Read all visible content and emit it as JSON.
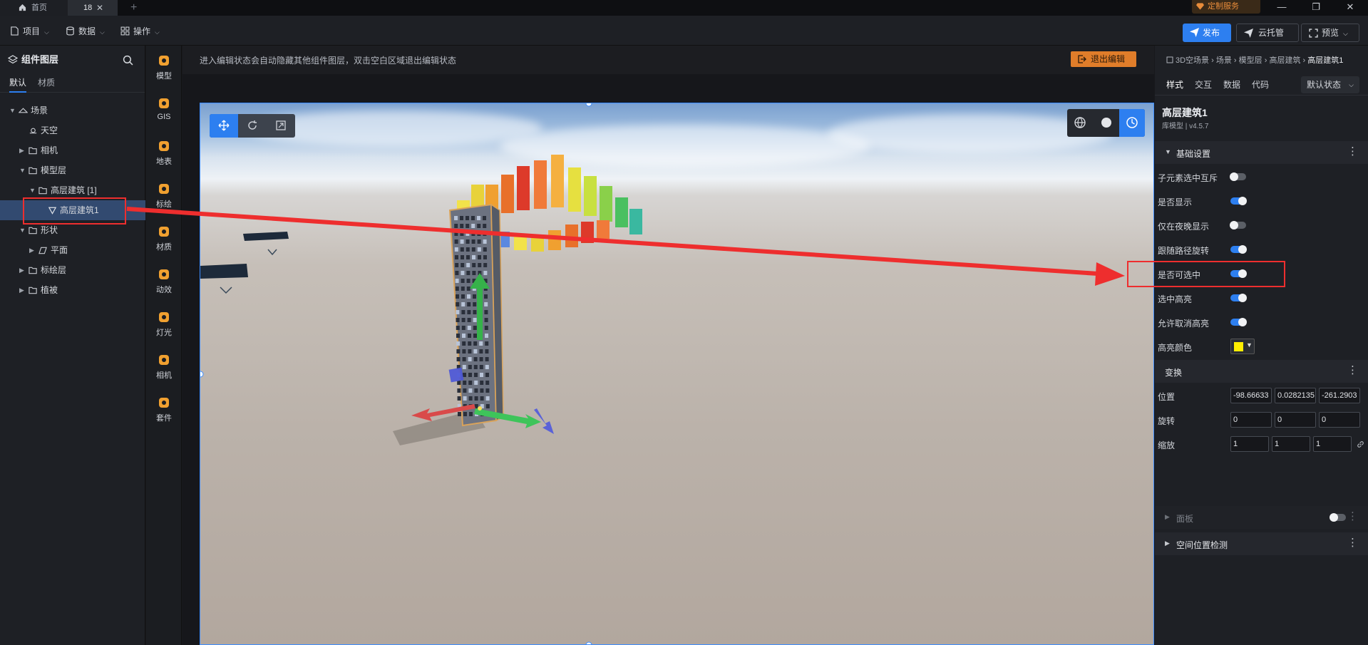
{
  "tabs": {
    "home": "首页",
    "current": "18",
    "add": "+"
  },
  "custom_service": "定制服务",
  "window": {
    "minimize": "—",
    "restore": "❐",
    "close": "✕"
  },
  "menus": {
    "project": "项目",
    "data": "数据",
    "operate": "操作"
  },
  "actions": {
    "publish": "发布",
    "cloud": "云托管",
    "preview": "预览"
  },
  "layers": {
    "title": "组件图层",
    "tabs": {
      "default": "默认",
      "material": "材质"
    },
    "tree": [
      {
        "label": "场景",
        "level": 0,
        "arrow": "▼",
        "icon": "scene-icon"
      },
      {
        "label": "天空",
        "level": 1,
        "arrow": "",
        "icon": "sky-icon"
      },
      {
        "label": "相机",
        "level": 1,
        "arrow": "▶",
        "icon": "folder-icon"
      },
      {
        "label": "模型层",
        "level": 1,
        "arrow": "▼",
        "icon": "folder-icon"
      },
      {
        "label": "高层建筑 [1]",
        "level": 2,
        "arrow": "▼",
        "icon": "folder-icon"
      },
      {
        "label": "高层建筑1",
        "level": 3,
        "arrow": "",
        "icon": "model-icon",
        "selected": true
      },
      {
        "label": "形状",
        "level": 1,
        "arrow": "▼",
        "icon": "folder-icon"
      },
      {
        "label": "平面",
        "level": 2,
        "arrow": "▶",
        "icon": "plane-icon"
      },
      {
        "label": "标绘层",
        "level": 1,
        "arrow": "▶",
        "icon": "folder-icon"
      },
      {
        "label": "植被",
        "level": 1,
        "arrow": "▶",
        "icon": "folder-icon"
      }
    ]
  },
  "rail": [
    {
      "label": "模型",
      "icon": "model-icon"
    },
    {
      "label": "GIS",
      "icon": "gis-icon"
    },
    {
      "label": "地表",
      "icon": "terrain-icon"
    },
    {
      "label": "标绘",
      "icon": "pin-icon"
    },
    {
      "label": "材质",
      "icon": "material-icon"
    },
    {
      "label": "动效",
      "icon": "effect-icon"
    },
    {
      "label": "灯光",
      "icon": "light-icon"
    },
    {
      "label": "相机",
      "icon": "camera-icon"
    },
    {
      "label": "套件",
      "icon": "kit-icon"
    }
  ],
  "canvas": {
    "hint": "进入编辑状态会自动隐藏其他组件图层，双击空白区域退出编辑状态",
    "exit": "退出编辑"
  },
  "props": {
    "breadcrumb": [
      "3D空场景",
      "场景",
      "模型层",
      "高层建筑",
      "高层建筑1"
    ],
    "tabs": {
      "style": "样式",
      "interact": "交互",
      "data": "数据",
      "code": "代码"
    },
    "state": "默认状态",
    "title": "高层建筑1",
    "subtitle": "库模型 | v4.5.7",
    "basic_section": "基础设置",
    "toggles": [
      {
        "label": "子元素选中互斥",
        "on": false
      },
      {
        "label": "是否显示",
        "on": true
      },
      {
        "label": "仅在夜晚显示",
        "on": false
      },
      {
        "label": "跟随路径旋转",
        "on": true
      },
      {
        "label": "是否可选中",
        "on": true
      },
      {
        "label": "选中高亮",
        "on": true
      },
      {
        "label": "允许取消高亮",
        "on": true
      }
    ],
    "highlight_color_label": "高亮颜色",
    "highlight_color": "#ffee00",
    "transform_section": "变换",
    "position_label": "位置",
    "position": [
      "-98.66633",
      "0.0282135",
      "-261.2903"
    ],
    "rotation_label": "旋转",
    "rotation": [
      "0",
      "0",
      "0"
    ],
    "scale_label": "缩放",
    "scale": [
      "1",
      "1",
      "1"
    ],
    "panel_section": "面板",
    "spatial_section": "空间位置检测"
  },
  "colors": {
    "accent": "#2d7ff0",
    "exit": "#e07d2a",
    "annotation": "#ee2e2e"
  }
}
